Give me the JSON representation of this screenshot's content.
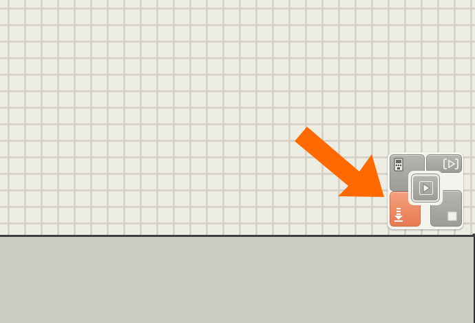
{
  "window": {
    "canvas": {
      "name": "program-canvas"
    },
    "lower_panel": {
      "name": "configuration-panel"
    }
  },
  "annotation": {
    "arrow_color": "#ff6a00",
    "points_to": "download-and-run-button"
  },
  "controller": {
    "buttons": [
      {
        "id": "nxt-window",
        "icon": "nxt-brick-icon"
      },
      {
        "id": "download-and-run-selected",
        "icon": "run-selected-icon"
      },
      {
        "id": "download-and-run",
        "icon": "play-icon"
      },
      {
        "id": "download",
        "icon": "download-icon",
        "highlighted": true,
        "color": "#ed8661"
      },
      {
        "id": "stop",
        "icon": "stop-icon"
      }
    ]
  },
  "colors": {
    "canvas_bg": "#eeede4",
    "grid_line": "#d2d0c6",
    "panel_bg": "#cdccc3",
    "button_gray": "#a9a9a3",
    "button_highlight": "#ed8661"
  }
}
